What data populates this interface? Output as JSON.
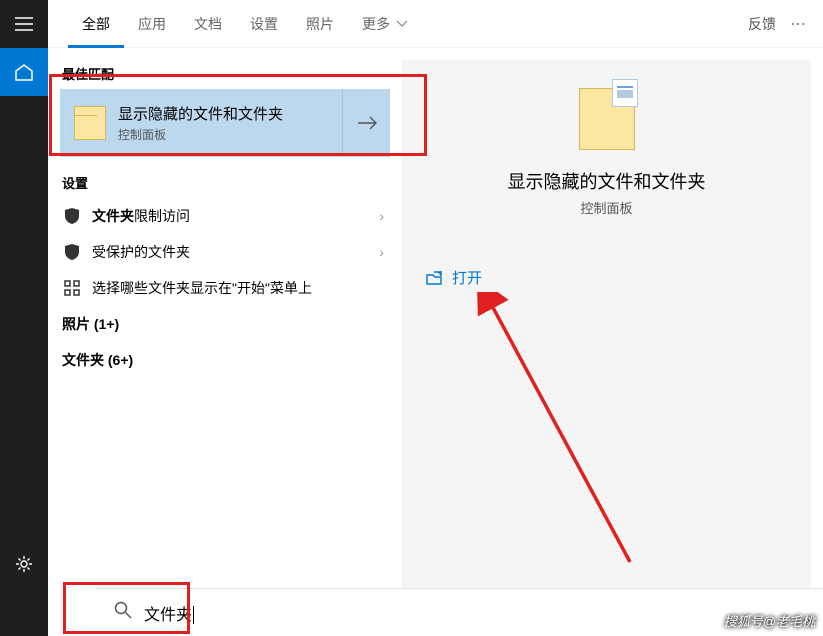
{
  "tabs": {
    "items": [
      "全部",
      "应用",
      "文档",
      "设置",
      "照片",
      "更多"
    ],
    "feedback": "反馈"
  },
  "left": {
    "best_match_label": "最佳匹配",
    "best": {
      "title": "显示隐藏的文件和文件夹",
      "sub": "控制面板"
    },
    "settings_label": "设置",
    "items": [
      {
        "bold": "文件夹",
        "rest": "限制访问",
        "icon": "shield"
      },
      {
        "bold": "",
        "rest": "受保护的文件夹",
        "icon": "shield"
      },
      {
        "bold": "",
        "rest": "选择哪些文件夹显示在\"开始\"菜单上",
        "icon": "grid"
      }
    ],
    "photos": "照片 (1+)",
    "folders": "文件夹 (6+)"
  },
  "right": {
    "title": "显示隐藏的文件和文件夹",
    "sub": "控制面板",
    "open": "打开"
  },
  "search": {
    "value": "文件夹"
  },
  "watermark": "搜狐号@老毛桃"
}
